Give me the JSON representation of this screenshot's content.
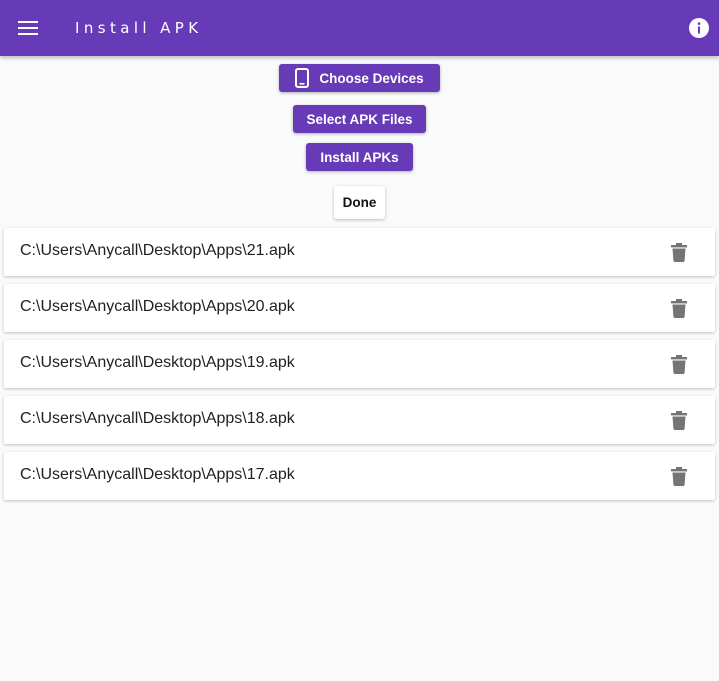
{
  "appbar": {
    "title": "Install APK",
    "menu_icon": "menu-icon",
    "info_icon": "info-icon",
    "color": "#673ab7"
  },
  "actions": {
    "choose_devices": "Choose Devices",
    "choose_devices_icon": "phone-icon",
    "select_apk_files": "Select APK Files",
    "install_apks": "Install APKs",
    "done": "Done"
  },
  "files": [
    {
      "path": "C:\\Users\\Anycall\\Desktop\\Apps\\21.apk"
    },
    {
      "path": "C:\\Users\\Anycall\\Desktop\\Apps\\20.apk"
    },
    {
      "path": "C:\\Users\\Anycall\\Desktop\\Apps\\19.apk"
    },
    {
      "path": "C:\\Users\\Anycall\\Desktop\\Apps\\18.apk"
    },
    {
      "path": "C:\\Users\\Anycall\\Desktop\\Apps\\17.apk"
    }
  ],
  "file_delete_icon": "trash-icon"
}
